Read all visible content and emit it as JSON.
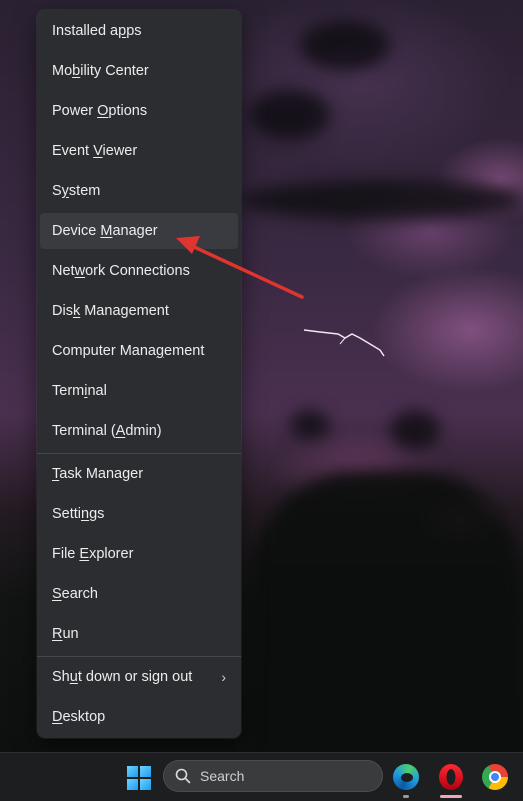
{
  "menu": {
    "group1": [
      {
        "pre": "Installed a",
        "key": "p",
        "post": "ps"
      },
      {
        "pre": "Mo",
        "key": "b",
        "post": "ility Center"
      },
      {
        "pre": "Power ",
        "key": "O",
        "post": "ptions"
      },
      {
        "pre": "Event ",
        "key": "V",
        "post": "iewer"
      },
      {
        "pre": "S",
        "key": "y",
        "post": "stem"
      },
      {
        "pre": "Device ",
        "key": "M",
        "post": "anager"
      },
      {
        "pre": "Net",
        "key": "w",
        "post": "ork Connections"
      },
      {
        "pre": "Dis",
        "key": "k",
        "post": " Management"
      },
      {
        "pre": "Computer Mana",
        "key": "g",
        "post": "ement"
      },
      {
        "pre": "Term",
        "key": "i",
        "post": "nal"
      },
      {
        "pre": "Terminal (",
        "key": "A",
        "post": "dmin)"
      }
    ],
    "group2": [
      {
        "pre": "",
        "key": "T",
        "post": "ask Manager"
      },
      {
        "pre": "Setti",
        "key": "n",
        "post": "gs"
      },
      {
        "pre": "File ",
        "key": "E",
        "post": "xplorer"
      },
      {
        "pre": "",
        "key": "S",
        "post": "earch"
      },
      {
        "pre": "",
        "key": "R",
        "post": "un"
      }
    ],
    "group3": [
      {
        "pre": "Sh",
        "key": "u",
        "post": "t down or sign out",
        "submenu": true
      },
      {
        "pre": "",
        "key": "D",
        "post": "esktop"
      }
    ],
    "highlighted": "Device Manager",
    "chevron_glyph": "›"
  },
  "annotation": {
    "type": "arrow",
    "color": "#e0342f",
    "points_to": "Device Manager"
  },
  "taskbar": {
    "search_placeholder": "Search",
    "apps": [
      {
        "name": "Microsoft Edge",
        "icon": "edge-icon",
        "running": true
      },
      {
        "name": "Opera",
        "icon": "opera-icon",
        "running": true,
        "active": true
      },
      {
        "name": "Google Chrome",
        "icon": "chrome-icon",
        "running": false
      }
    ]
  }
}
